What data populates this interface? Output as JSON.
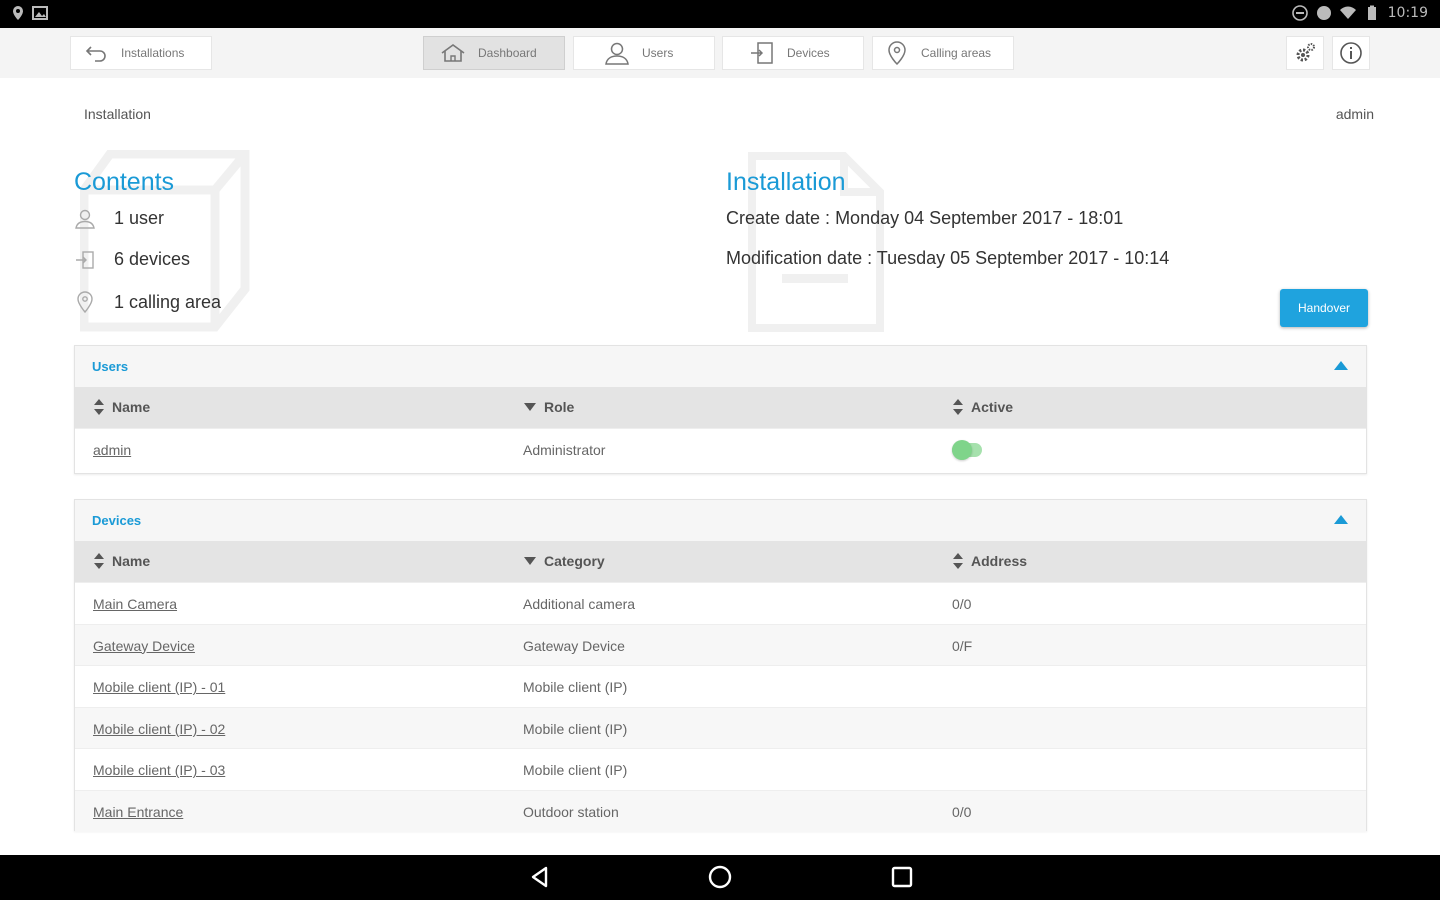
{
  "status_bar": {
    "time": "10:19"
  },
  "nav": {
    "back_label": "Installations",
    "tabs": [
      {
        "label": "Dashboard",
        "icon": "home-icon",
        "active": true
      },
      {
        "label": "Users",
        "icon": "user-icon",
        "active": false
      },
      {
        "label": "Devices",
        "icon": "device-icon",
        "active": false
      },
      {
        "label": "Calling areas",
        "icon": "location-pin-icon",
        "active": false
      }
    ],
    "right_icons": [
      "settings-gears-icon",
      "info-icon"
    ]
  },
  "breadcrumb": "Installation",
  "current_user": "admin",
  "contents": {
    "title": "Contents",
    "items": [
      {
        "icon": "user-icon",
        "text": "1 user"
      },
      {
        "icon": "device-icon",
        "text": "6 devices"
      },
      {
        "icon": "location-pin-icon",
        "text": "1 calling area"
      }
    ]
  },
  "installation": {
    "title": "Installation",
    "create_date": "Create date : Monday 04 September 2017 - 18:01",
    "modification_date": "Modification date : Tuesday 05 September 2017 - 10:14",
    "handover_label": "Handover"
  },
  "users_panel": {
    "title": "Users",
    "columns": [
      "Name",
      "Role",
      "Active"
    ],
    "rows": [
      {
        "name": "admin",
        "role": "Administrator",
        "active": true
      }
    ]
  },
  "devices_panel": {
    "title": "Devices",
    "columns": [
      "Name",
      "Category",
      "Address"
    ],
    "rows": [
      {
        "name": "Main Camera",
        "category": "Additional camera",
        "address": "0/0"
      },
      {
        "name": "Gateway Device",
        "category": "Gateway Device",
        "address": "0/F"
      },
      {
        "name": "Mobile client (IP) - 01",
        "category": "Mobile client (IP)",
        "address": ""
      },
      {
        "name": "Mobile client (IP) - 02",
        "category": "Mobile client (IP)",
        "address": ""
      },
      {
        "name": "Mobile client (IP) - 03",
        "category": "Mobile client (IP)",
        "address": ""
      },
      {
        "name": "Main Entrance",
        "category": "Outdoor station",
        "address": "0/0"
      }
    ]
  },
  "colors": {
    "accent": "#1a9ad6",
    "button": "#1fa3de",
    "toggle_on": "#7fd48a"
  }
}
